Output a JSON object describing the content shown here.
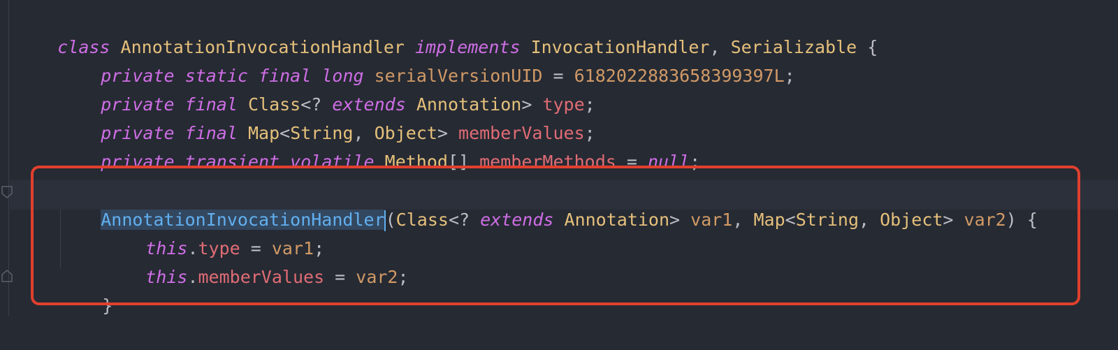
{
  "code": {
    "class_decl": {
      "kw_class": "class",
      "class_name": "AnnotationInvocationHandler",
      "kw_implements": "implements",
      "iface1": "InvocationHandler",
      "comma": ", ",
      "iface2": "Serializable",
      "brace": " {"
    },
    "field1": {
      "kw_private": "private",
      "kw_static": "static",
      "kw_final": "final",
      "kw_long": "long",
      "name": "serialVersionUID",
      "eq": " = ",
      "value": "6182022883658399397L",
      "semi": ";"
    },
    "field2": {
      "kw_private": "private",
      "kw_final": "final",
      "type_class": "Class",
      "wildcard": "<? ",
      "kw_extends": "extends",
      "type_annotation": "Annotation",
      "close": "> ",
      "name": "type",
      "semi": ";"
    },
    "field3": {
      "kw_private": "private",
      "kw_final": "final",
      "type_map": "Map",
      "lt": "<",
      "type_string": "String",
      "comma": ", ",
      "type_object": "Object",
      "gt": "> ",
      "name": "memberValues",
      "semi": ";"
    },
    "field4": {
      "kw_private": "private",
      "kw_transient": "transient",
      "kw_volatile": "volatile",
      "type_method": "Method",
      "arr": "[] ",
      "name": "memberMethods",
      "eq": " = ",
      "kw_null": "null",
      "semi": ";"
    },
    "ctor": {
      "name": "AnnotationInvocationHandler",
      "open": "(",
      "type_class": "Class",
      "wildcard": "<? ",
      "kw_extends": "extends",
      "type_annotation": "Annotation",
      "gt1": "> ",
      "param1": "var1",
      "comma1": ", ",
      "type_map": "Map",
      "lt": "<",
      "type_string": "String",
      "comma2": ", ",
      "type_object": "Object",
      "gt2": "> ",
      "param2": "var2",
      "close": ") {"
    },
    "stmt1": {
      "kw_this": "this",
      "dot": ".",
      "field": "type",
      "eq": " = ",
      "value": "var1",
      "semi": ";"
    },
    "stmt2": {
      "kw_this": "this",
      "dot": ".",
      "field": "memberValues",
      "eq": " = ",
      "value": "var2",
      "semi": ";"
    },
    "ctor_close": "}"
  },
  "colors": {
    "background": "#262a33",
    "keyword": "#cf6ee6",
    "type": "#e5c07b",
    "field": "#e06c75",
    "number": "#d19a66",
    "function_selected": "#61afef",
    "highlight_border": "#e0402e"
  },
  "icons": [
    "fold-start-icon",
    "fold-end-icon"
  ]
}
